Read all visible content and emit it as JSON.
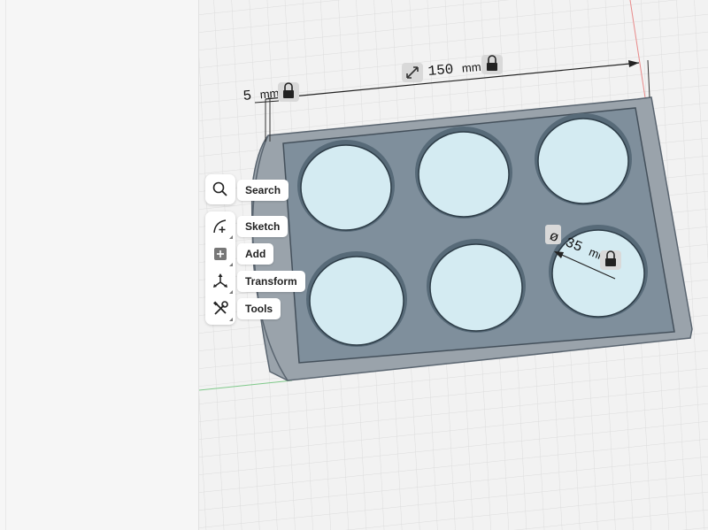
{
  "toolbar": {
    "items": [
      {
        "label": "Search",
        "icon": "search-icon"
      },
      {
        "label": "Sketch",
        "icon": "sketch-icon"
      },
      {
        "label": "Add",
        "icon": "add-icon"
      },
      {
        "label": "Transform",
        "icon": "transform-icon"
      },
      {
        "label": "Tools",
        "icon": "tools-icon"
      }
    ]
  },
  "dimensions": {
    "width": {
      "value": "150",
      "unit": "mm",
      "locked": true
    },
    "offset": {
      "value": "5",
      "unit": "mm",
      "locked": true
    },
    "hole_diameter": {
      "symbol": "ø",
      "value": "35",
      "unit": "mm",
      "locked": true
    }
  },
  "colors": {
    "tray_body": "#8e9aa6",
    "tray_floor": "#7f8f9c",
    "hole_fill": "#d4ebf2",
    "rim": "#9aa3ab",
    "grid_line": "#dedede",
    "axis_red": "#e88a8a",
    "axis_green": "#7fc98a"
  }
}
